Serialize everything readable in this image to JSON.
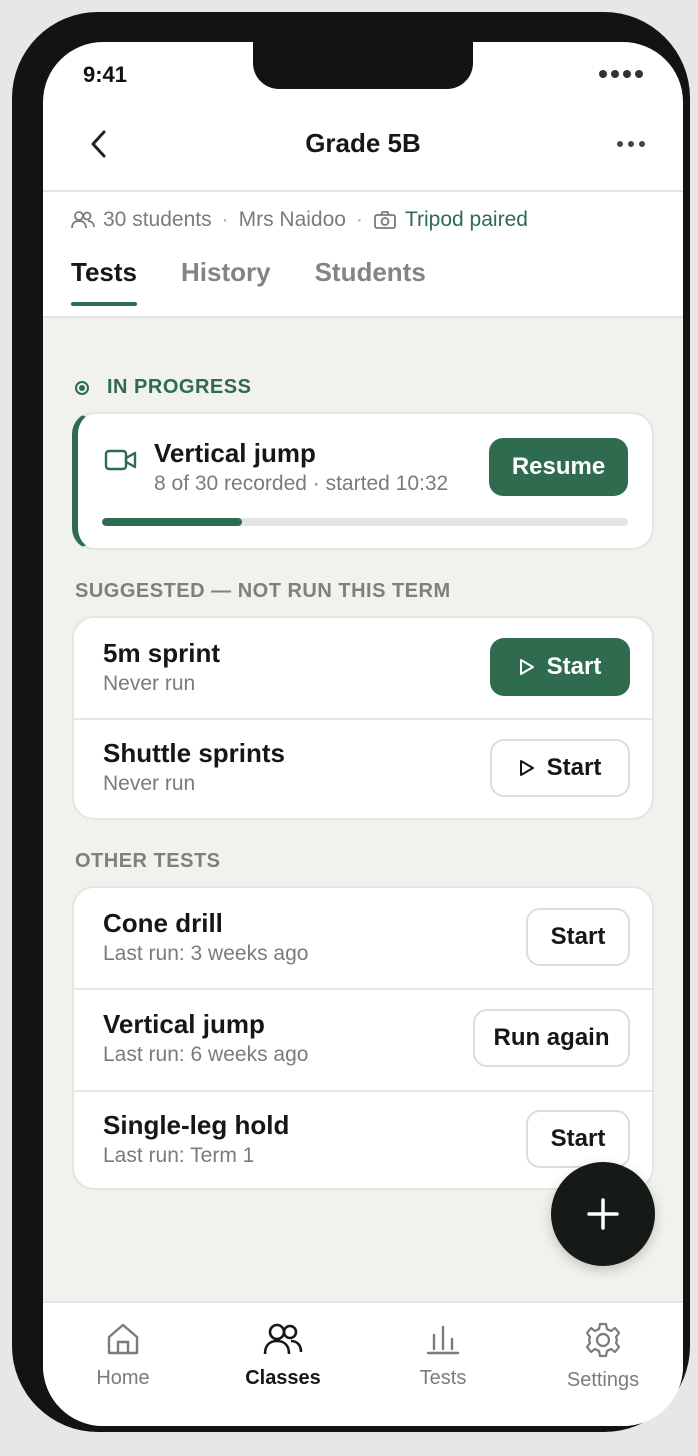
{
  "status_bar": {
    "time": "9:41"
  },
  "header": {
    "title": "Grade 5B"
  },
  "meta": {
    "students": "30 students",
    "separator": "·",
    "teacher": "Mrs Naidoo",
    "tripod": "Tripod paired"
  },
  "tabs": [
    {
      "label": "Tests",
      "active": true
    },
    {
      "label": "History",
      "active": false
    },
    {
      "label": "Students",
      "active": false
    }
  ],
  "in_progress": {
    "section_label": "IN PROGRESS",
    "title": "Vertical jump",
    "subtitle": "8 of 30 recorded · started 10:32",
    "button": "Resume",
    "recorded": 8,
    "total": 30
  },
  "suggested": {
    "section_label": "SUGGESTED — NOT RUN THIS TERM",
    "items": [
      {
        "title": "5m sprint",
        "subtitle": "Never run",
        "button": "Start",
        "primary": true
      },
      {
        "title": "Shuttle sprints",
        "subtitle": "Never run",
        "button": "Start",
        "primary": false
      }
    ]
  },
  "other": {
    "section_label": "OTHER TESTS",
    "items": [
      {
        "title": "Cone drill",
        "subtitle": "Last run: 3 weeks ago",
        "button": "Start"
      },
      {
        "title": "Vertical jump",
        "subtitle": "Last run: 6 weeks ago",
        "button": "Run again"
      },
      {
        "title": "Single-leg hold",
        "subtitle": "Last run: Term 1",
        "button": "Start"
      }
    ]
  },
  "bottom_nav": [
    {
      "label": "Home",
      "icon": "home-icon",
      "active": false
    },
    {
      "label": "Classes",
      "icon": "people-icon",
      "active": true
    },
    {
      "label": "Tests",
      "icon": "bar-chart-icon",
      "active": false
    },
    {
      "label": "Settings",
      "icon": "gear-icon",
      "active": false
    }
  ],
  "colors": {
    "accent": "#2e6b4f",
    "background": "#f1f1ed",
    "fab": "#151a17"
  }
}
